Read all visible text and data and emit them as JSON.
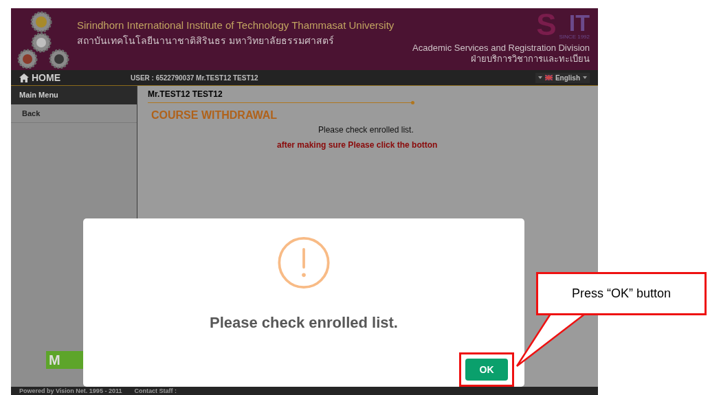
{
  "header": {
    "title": "Sirindhorn International Institute of Technology Thammasat University",
    "subtitle_thai": "สถาบันเทคโนโลยีนานาชาติสิรินธร  มหาวิทยาลัยธรรมศาสตร์",
    "logo_letters": [
      "S",
      "IT"
    ],
    "logo_since": "SINCE 1992",
    "division": "Academic Services and Registration Division",
    "division_thai": "ฝ่ายบริการวิชาการและทะเบียน"
  },
  "navbar": {
    "home": "HOME",
    "user": "USER : 6522790037 Mr.TEST12 TEST12",
    "language": "English"
  },
  "sidebar": {
    "heading": "Main Menu",
    "items": [
      {
        "label": "Back"
      }
    ],
    "logo_letter": "M"
  },
  "content": {
    "student_name": "Mr.TEST12 TEST12",
    "title": "COURSE WITHDRAWAL",
    "message": "Please check enrolled list.",
    "warning": "after making sure Please click the botton"
  },
  "dialog": {
    "message": "Please check enrolled list.",
    "button": "OK"
  },
  "callout": {
    "text": "Press “OK” button"
  },
  "footer": {
    "powered": "Powered by Vision Net. 1995 - 2011",
    "contact": "Contact Staff :"
  }
}
